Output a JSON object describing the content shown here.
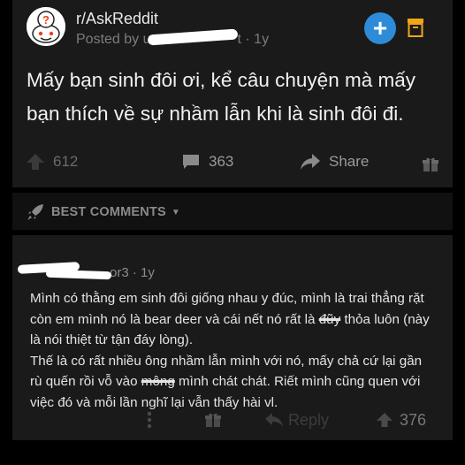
{
  "post": {
    "subreddit": "r/AskReddit",
    "posted_by_prefix": "Posted by u",
    "posted_by_suffix": "t · 1y",
    "title": "Mấy bạn sinh đôi ơi, kể câu chuyện mà mấy bạn thích về sự nhầm lẫn khi là sinh đôi đi.",
    "upvotes": "612",
    "comments": "363",
    "share_label": "Share"
  },
  "comments_header": {
    "label": "BEST COMMENTS"
  },
  "comment": {
    "author_visible": "or3 · 1y",
    "body_line_1": "Mình có thằng em sinh đôi giống nhau y đúc, mình là trai thẳng rặt còn em mình nó là bear deer và cái nết nó rất là ",
    "body_struck_1": "đũy",
    "body_line_1b": " thỏa luôn (này là nói thiệt từ tận đáy lòng).",
    "body_line_2": "Thế là có rất nhiều ông nhầm lẫn mình với nó, mấy chả cứ lại gần rù quến rồi vỗ vào ",
    "body_struck_2": "mông",
    "body_line_2b": " mình chát chát. Riết mình cũng quen với việc đó và mỗi lần nghĩ lại vẫn thấy hài vl.",
    "reply_label": "Reply",
    "upvotes": "376"
  },
  "colors": {
    "background": "#000000",
    "card": "#1a1a1b",
    "accent_blue": "#2e8bd8",
    "accent_orange": "#f2a51a"
  },
  "icons": [
    "reddit-snoo-avatar",
    "plus-icon",
    "archive-icon",
    "upvote-arrow-icon",
    "comment-bubble-icon",
    "share-arrow-icon",
    "award-gift-icon",
    "rocket-icon",
    "caret-down-icon",
    "more-dots-icon",
    "reply-arrow-icon"
  ]
}
